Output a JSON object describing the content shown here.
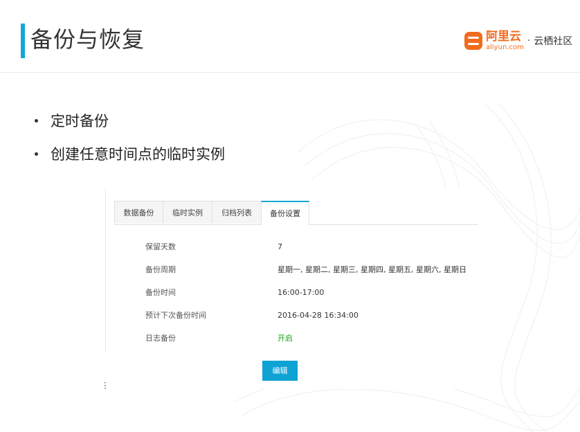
{
  "slide": {
    "title": "备份与恢复",
    "logo": {
      "brand": "阿里云",
      "domain": "aliyun.com",
      "separator": "·",
      "community": "云栖社区"
    },
    "bullets": [
      "定时备份",
      "创建任意时间点的临时实例"
    ]
  },
  "console": {
    "tabs": [
      {
        "label": "数据备份",
        "active": false
      },
      {
        "label": "临时实例",
        "active": false
      },
      {
        "label": "归档列表",
        "active": false
      },
      {
        "label": "备份设置",
        "active": true
      }
    ],
    "fields": [
      {
        "label": "保留天数",
        "value": "7"
      },
      {
        "label": "备份周期",
        "value": "星期一, 星期二, 星期三, 星期四, 星期五, 星期六, 星期日"
      },
      {
        "label": "备份时间",
        "value": "16:00-17:00"
      },
      {
        "label": "预计下次备份时间",
        "value": "2016-04-28 16:34:00"
      },
      {
        "label": "日志备份",
        "value": "开启"
      }
    ],
    "edit_button": "编辑"
  },
  "colors": {
    "accent": "#11a7d8",
    "brand_orange": "#f26b1d",
    "enabled_green": "#1f9e1f"
  }
}
